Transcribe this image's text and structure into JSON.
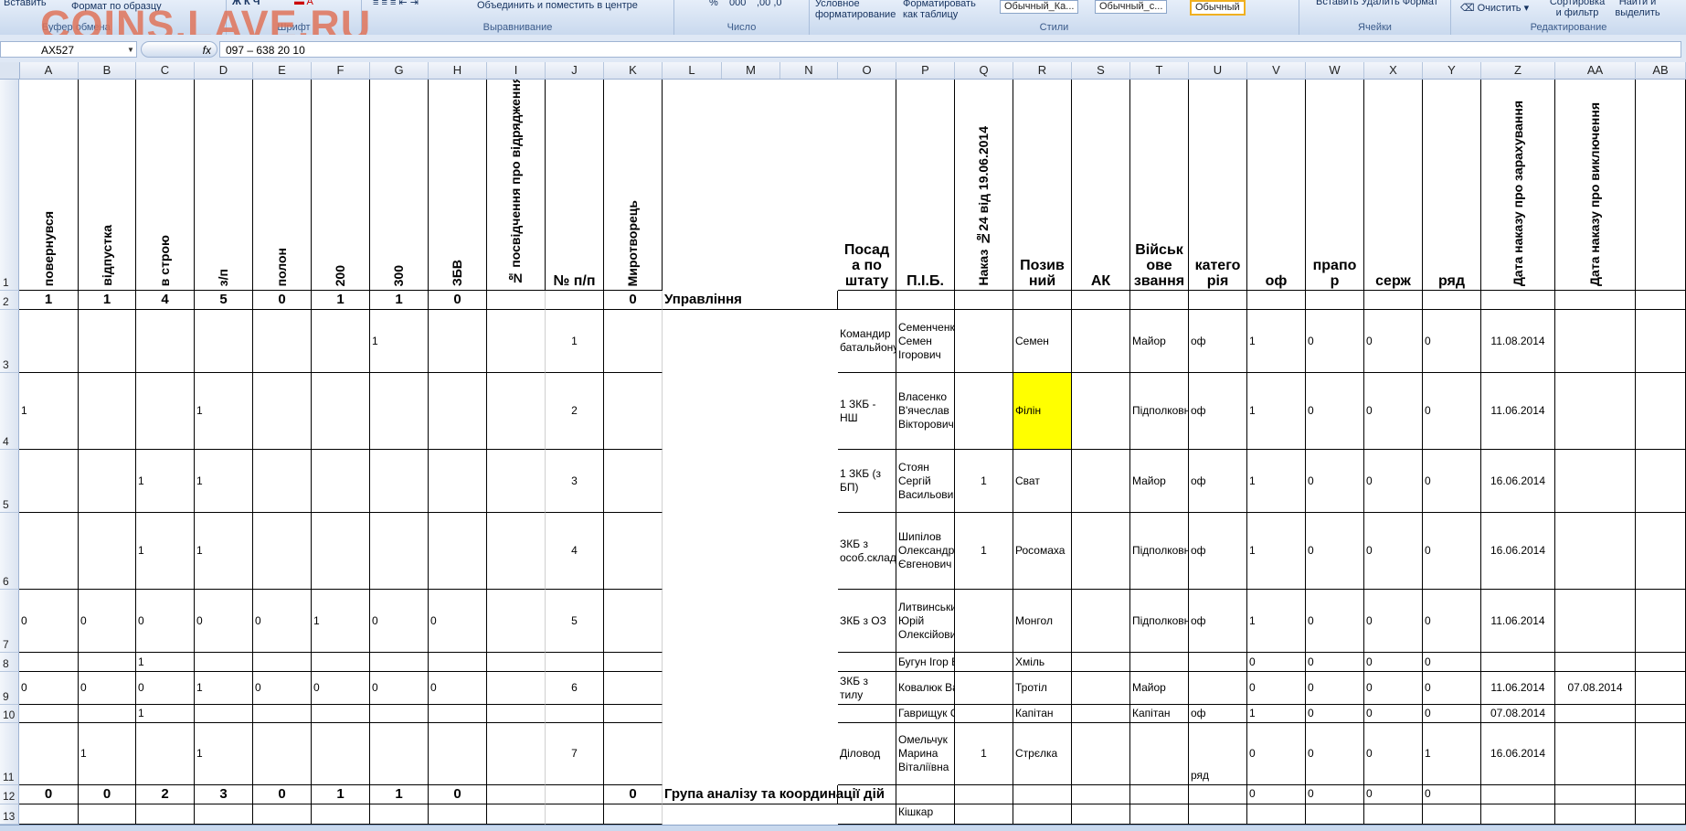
{
  "watermark": "COINS.LAVE.RU",
  "ribbon": {
    "format_painter": "Формат по образцу",
    "paste": "Вставить",
    "clipboard": "Буфер обмена",
    "font": "Шрифт",
    "merge_center": "Объединить и поместить в центре",
    "alignment": "Выравнивание",
    "number": "Число",
    "percent": "%",
    "thousands": "000",
    "conditional": "Условное форматирование",
    "format_table": "Форматировать как таблицу",
    "style1": "Обычный_Ка...",
    "style2": "Обычный_с...",
    "style3": "Обычный",
    "styles": "Стили",
    "insert_delete_format": "Вставить  Удалить  Формат",
    "cells": "Ячейки",
    "clear": "Очистить",
    "sort_filter": "Сортировка и фильтр",
    "find_select": "Найти и выделить",
    "editing": "Редактирование"
  },
  "formula_bar": {
    "name_box": "AX527",
    "fx": "fx",
    "formula": "097 – 638 20 10"
  },
  "columns": [
    "A",
    "B",
    "C",
    "D",
    "E",
    "F",
    "G",
    "H",
    "I",
    "J",
    "K",
    "L",
    "M",
    "N",
    "O",
    "P",
    "Q",
    "R",
    "S",
    "T",
    "U",
    "V",
    "W",
    "X",
    "Y",
    "Z",
    "AA",
    "AB"
  ],
  "headers": {
    "A": "повернувся",
    "B": "відпустка",
    "C": "в строю",
    "D": "з/п",
    "E": "полон",
    "F": "200",
    "G": "300",
    "H": "ЗБВ",
    "I": "№ посвідчення про відрядження",
    "J": "№ п/п",
    "K": "Миротворець",
    "O": "Посад а по штату",
    "P": "П.І.Б.",
    "Q": "Наказ №24 від 19.06.2014",
    "R": "Позив ний",
    "S": "АК",
    "T": "Військ ове звання",
    "U": "катего рія",
    "V": "оф",
    "W": "прапо р",
    "X": "серж",
    "Y": "ряд",
    "Z": "Дата наказу про зарахування",
    "AA": "Дата наказу про виключення"
  },
  "rows": {
    "r2": {
      "A": "1",
      "B": "1",
      "C": "4",
      "D": "5",
      "E": "0",
      "F": "1",
      "G": "1",
      "H": "0",
      "K": "0",
      "L": "Управління"
    },
    "r3": {
      "G": "1",
      "J": "1",
      "O": "Командир батальйону",
      "P": "Семенченко Семен Ігорович",
      "R": "Семен",
      "T": "Майор",
      "U": "оф",
      "V": "1",
      "W": "0",
      "X": "0",
      "Y": "0",
      "Z": "11.08.2014"
    },
    "r4": {
      "A": "1",
      "D": "1",
      "J": "2",
      "O": "1 ЗКБ - НШ",
      "P": "Власенко В'ячеслав Вікторович",
      "R": "Філін",
      "T": "Підполковник",
      "U": "оф",
      "V": "1",
      "W": "0",
      "X": "0",
      "Y": "0",
      "Z": "11.06.2014"
    },
    "r5": {
      "C": "1",
      "D": "1",
      "J": "3",
      "O": "1 ЗКБ (з БП)",
      "P": "Стоян Сергій Васильович",
      "Q": "1",
      "R": "Сват",
      "T": "Майор",
      "U": "оф",
      "V": "1",
      "W": "0",
      "X": "0",
      "Y": "0",
      "Z": "16.06.2014"
    },
    "r6": {
      "C": "1",
      "D": "1",
      "J": "4",
      "O": "ЗКБ з особ.складу",
      "P": "Шипілов Олександр Євгенович",
      "Q": "1",
      "R": "Росомаха",
      "T": "Підполковник",
      "U": "оф",
      "V": "1",
      "W": "0",
      "X": "0",
      "Y": "0",
      "Z": "16.06.2014"
    },
    "r7": {
      "A": "0",
      "B": "0",
      "C": "0",
      "D": "0",
      "E": "0",
      "F": "1",
      "G": "0",
      "H": "0",
      "J": "5",
      "O": "ЗКБ з ОЗ",
      "P": "Литвинський Юрій Олексійович",
      "R": "Монгол",
      "T": "Підполковник",
      "U": "оф",
      "V": "1",
      "W": "0",
      "X": "0",
      "Y": "0",
      "Z": "11.06.2014"
    },
    "r8": {
      "C": "1",
      "P": "Бугун Ігор Володимирович",
      "R": "Хміль",
      "V": "0",
      "W": "0",
      "X": "0",
      "Y": "0"
    },
    "r9": {
      "A": "0",
      "B": "0",
      "C": "0",
      "D": "1",
      "E": "0",
      "F": "0",
      "G": "0",
      "H": "0",
      "J": "6",
      "O": "ЗКБ з тилу",
      "P": "Ковалюк Василь Ми",
      "R": "Тротіл",
      "T": "Майор",
      "V": "0",
      "W": "0",
      "X": "0",
      "Y": "0",
      "Z": "11.06.2014",
      "AA": "07.08.2014"
    },
    "r10": {
      "C": "1",
      "P": "Гаврищук Олександр",
      "R": "Капітан",
      "T": "Капітан",
      "U": "оф",
      "V": "1",
      "W": "0",
      "X": "0",
      "Y": "0",
      "Z": "07.08.2014"
    },
    "r11": {
      "B": "1",
      "D": "1",
      "J": "7",
      "O": "Діловод",
      "P": "Омельчук Марина Віталіївна",
      "Q": "1",
      "R": "Стрєлка",
      "U": "ряд",
      "V": "0",
      "W": "0",
      "X": "0",
      "Y": "1",
      "Z": "16.06.2014"
    },
    "r12": {
      "A": "0",
      "B": "0",
      "C": "2",
      "D": "3",
      "E": "0",
      "F": "1",
      "G": "1",
      "H": "0",
      "K": "0",
      "L": "Група аналізу та координації дій",
      "V": "0",
      "W": "0",
      "X": "0",
      "Y": "0"
    },
    "r13": {
      "P": "Кішкар"
    }
  }
}
